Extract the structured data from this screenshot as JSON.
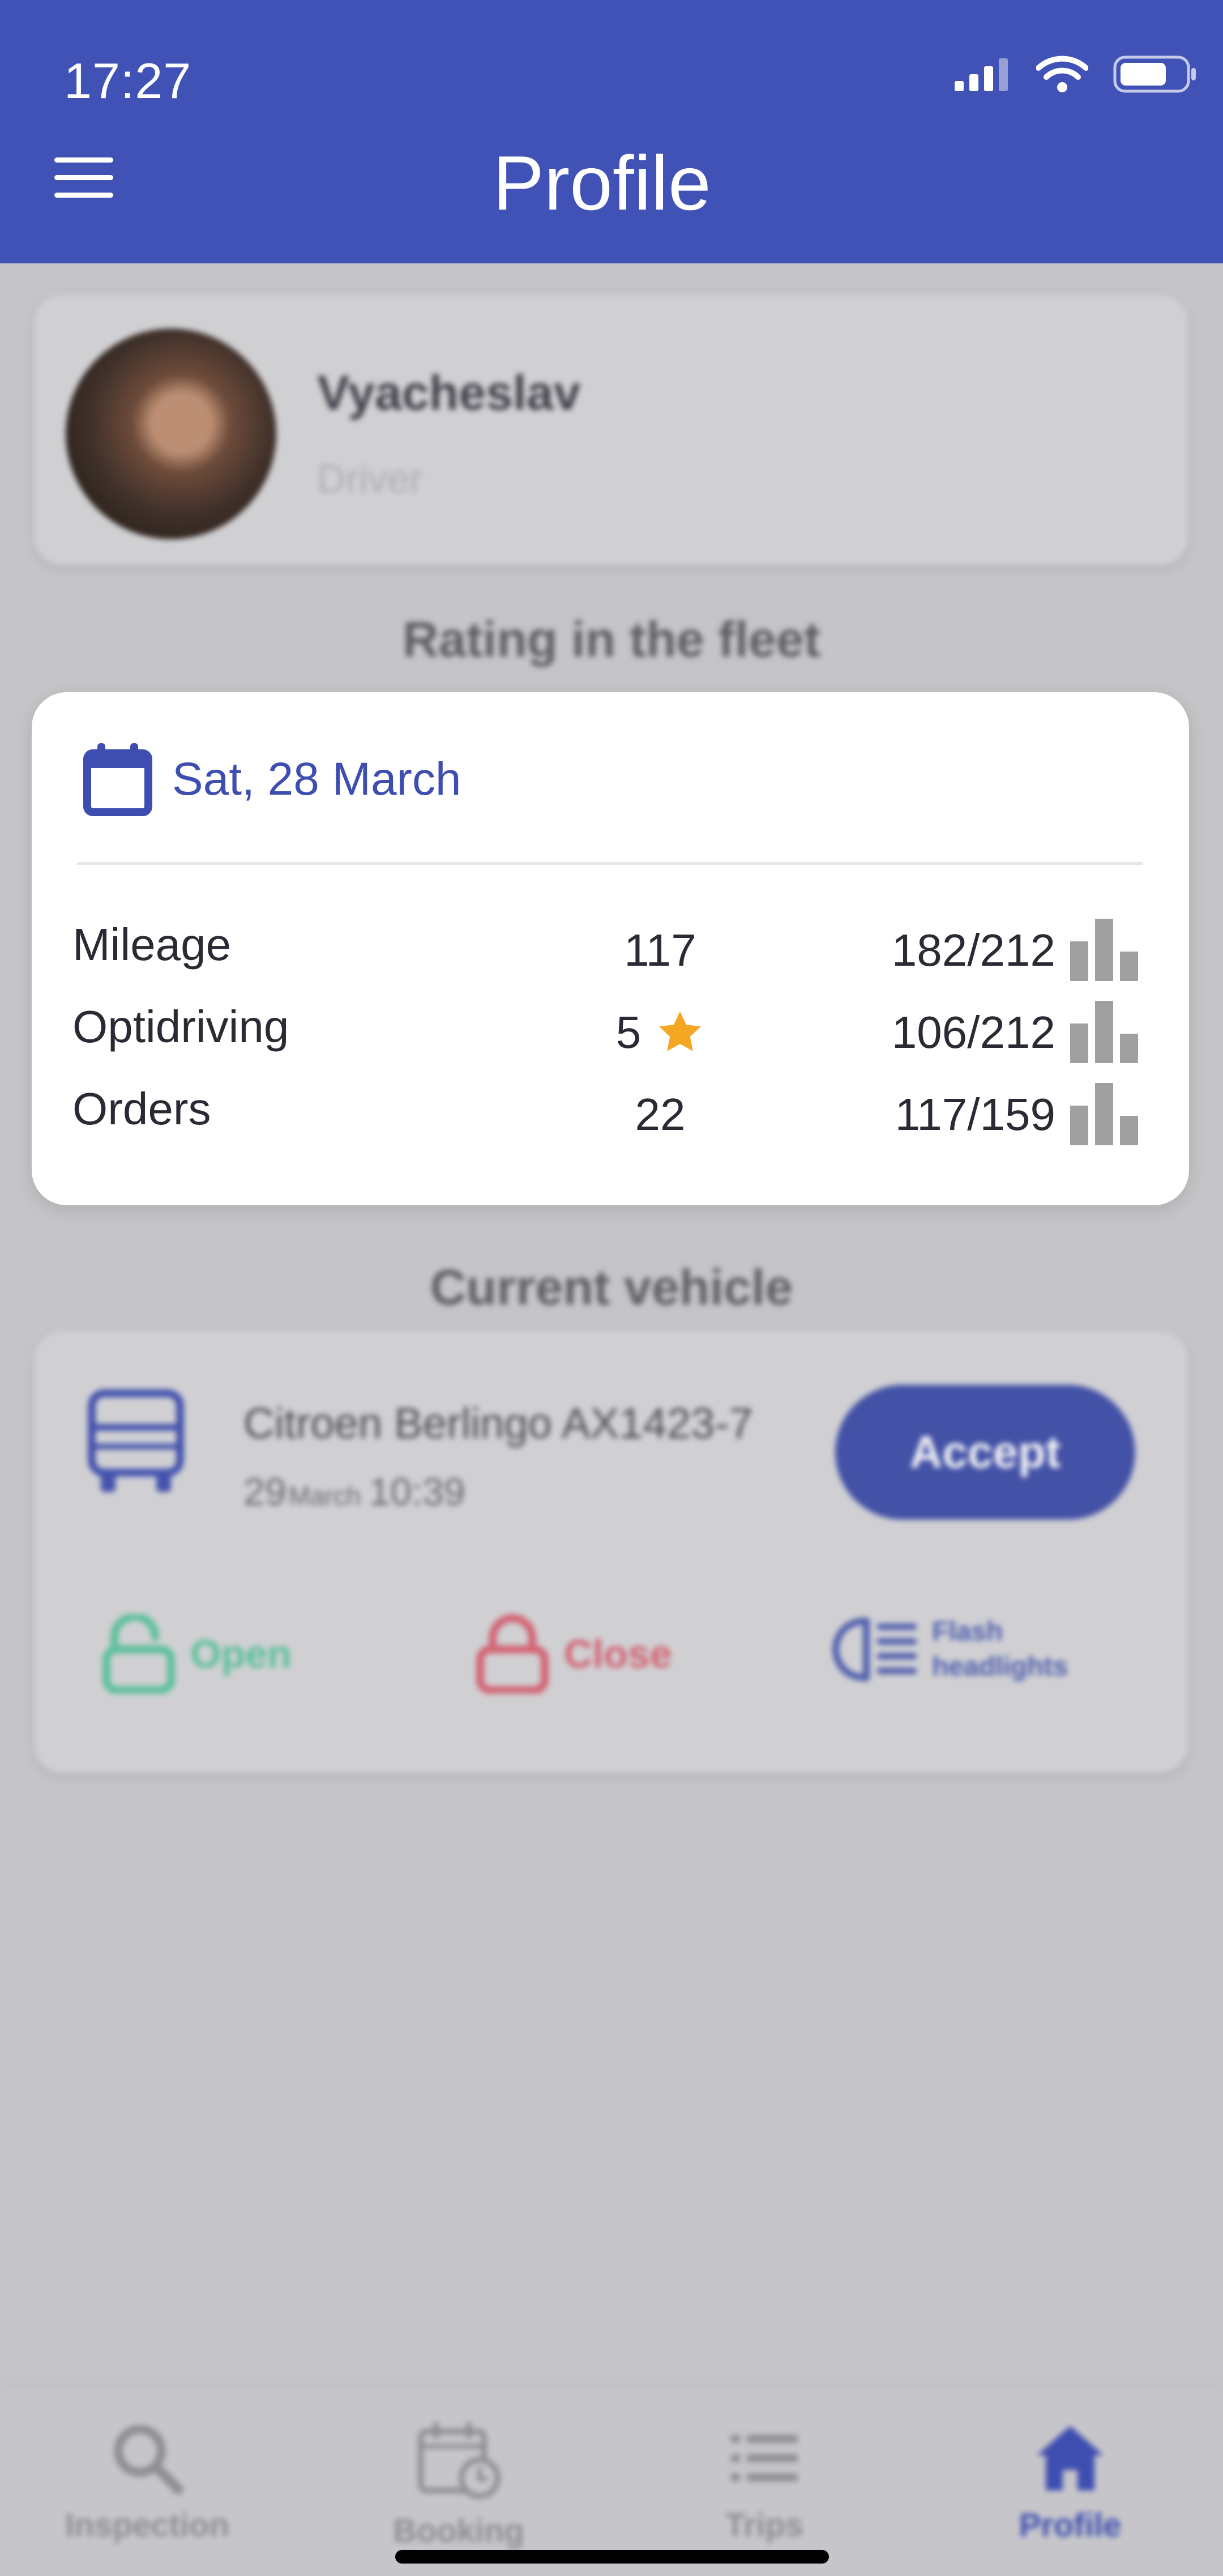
{
  "status_bar": {
    "time": "17:27"
  },
  "header": {
    "title": "Profile"
  },
  "profile": {
    "name": "Vyacheslav",
    "role": "Driver"
  },
  "rating_section": {
    "title": "Rating in the fleet"
  },
  "rating_popup": {
    "date": "Sat, 28 March",
    "rows": [
      {
        "label": "Mileage",
        "value": "117",
        "rank": "182/212"
      },
      {
        "label": "Optidriving",
        "value": "5",
        "rank": "106/212"
      },
      {
        "label": "Orders",
        "value": "22",
        "rank": "117/159"
      }
    ]
  },
  "vehicle_section": {
    "title": "Current vehicle"
  },
  "vehicle": {
    "name": "Citroen Berlingo AX1423-7",
    "day": "29",
    "month": "March",
    "time": "10:39",
    "accept_label": "Accept",
    "actions": {
      "open_label": "Open",
      "close_label": "Close",
      "flash_label": "Flash headlights"
    }
  },
  "tabs": [
    {
      "label": "Inspection",
      "icon": "search-icon"
    },
    {
      "label": "Booking",
      "icon": "calendar-clock-icon"
    },
    {
      "label": "Trips",
      "icon": "list-icon"
    },
    {
      "label": "Profile",
      "icon": "home-icon",
      "active": true
    }
  ],
  "colors": {
    "primary": "#4152b6",
    "open": "#58c49a",
    "close": "#d86070",
    "star": "#f5a623",
    "chart": "#a0a0a0"
  }
}
